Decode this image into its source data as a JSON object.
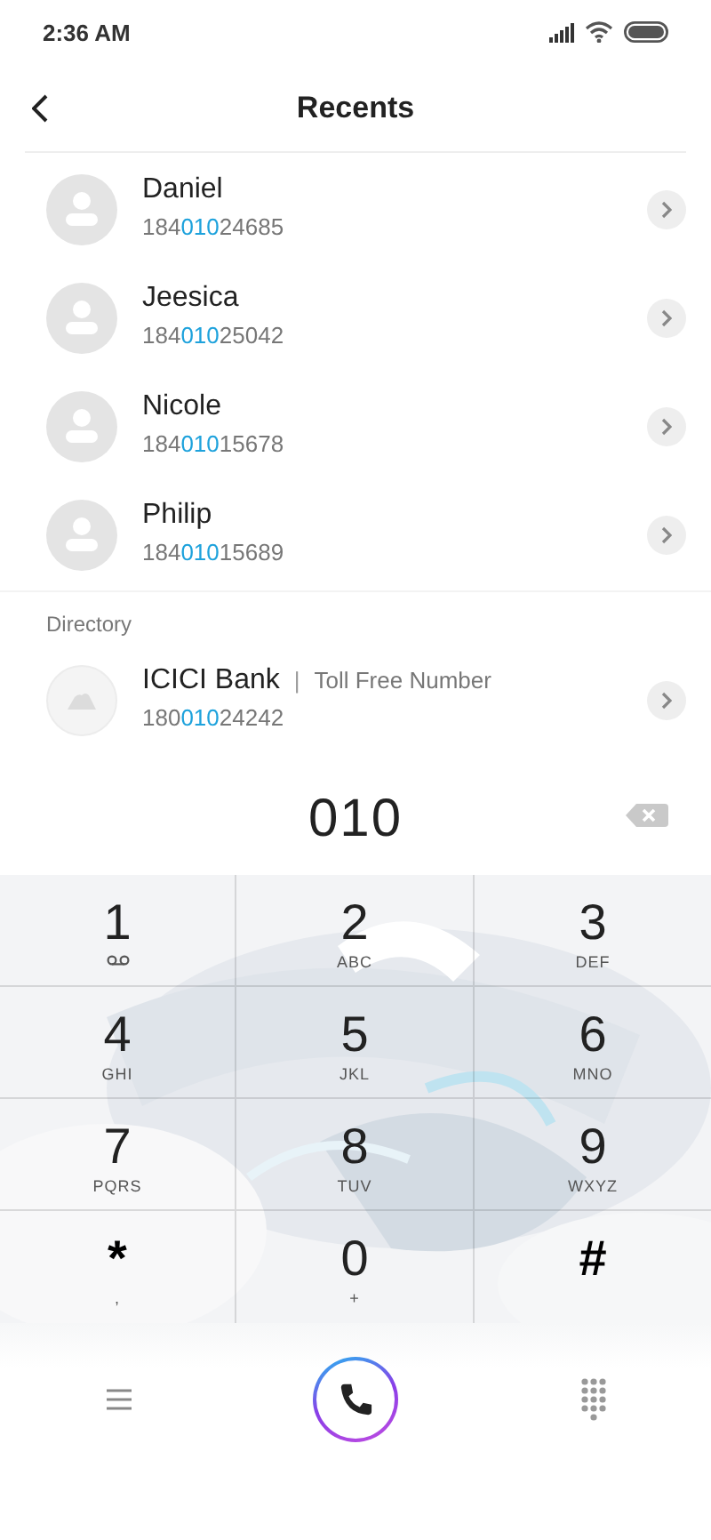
{
  "status_bar": {
    "time": "2:36 AM"
  },
  "header": {
    "title": "Recents"
  },
  "contacts": [
    {
      "name": "Daniel",
      "number_before": "184",
      "number_match": "010",
      "number_after": "24685"
    },
    {
      "name": "Jeesica",
      "number_before": "184",
      "number_match": "010",
      "number_after": "25042"
    },
    {
      "name": "Nicole",
      "number_before": "184",
      "number_match": "010",
      "number_after": "15678"
    },
    {
      "name": "Philip",
      "number_before": "184",
      "number_match": "010",
      "number_after": "15689"
    }
  ],
  "directory": {
    "label": "Directory",
    "entries": [
      {
        "name": "ICICI Bank",
        "separator": "|",
        "tag": "Toll Free Number",
        "number_before": "180",
        "number_match": "010",
        "number_after": "24242"
      }
    ]
  },
  "dial": {
    "value": "010"
  },
  "keys": [
    {
      "digit": "1",
      "kind": "voicemail"
    },
    {
      "digit": "2",
      "kind": "letters",
      "sub": "ABC"
    },
    {
      "digit": "3",
      "kind": "letters",
      "sub": "DEF"
    },
    {
      "digit": "4",
      "kind": "letters",
      "sub": "GHI"
    },
    {
      "digit": "5",
      "kind": "letters",
      "sub": "JKL"
    },
    {
      "digit": "6",
      "kind": "letters",
      "sub": "MNO"
    },
    {
      "digit": "7",
      "kind": "letters",
      "sub": "PQRS"
    },
    {
      "digit": "8",
      "kind": "letters",
      "sub": "TUV"
    },
    {
      "digit": "9",
      "kind": "letters",
      "sub": "WXYZ"
    },
    {
      "digit": "*",
      "kind": "symbol",
      "sub": ","
    },
    {
      "digit": "0",
      "kind": "letters",
      "sub": "+"
    },
    {
      "digit": "#",
      "kind": "symbol"
    }
  ]
}
